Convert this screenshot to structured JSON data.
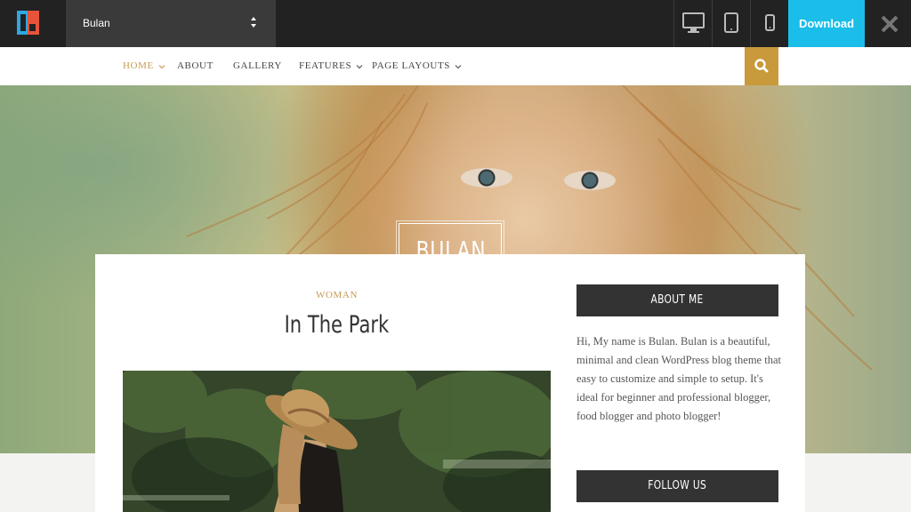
{
  "preview_bar": {
    "theme_name": "Bulan",
    "download_label": "Download",
    "devices": [
      "desktop-icon",
      "tablet-icon",
      "mobile-icon"
    ],
    "colors": {
      "bar": "#222222",
      "download": "#1bbde9"
    }
  },
  "site_nav": {
    "items": [
      {
        "label": "HOME",
        "dropdown": true,
        "active": true
      },
      {
        "label": "ABOUT",
        "dropdown": false,
        "active": false
      },
      {
        "label": "GALLERY",
        "dropdown": false,
        "active": false
      },
      {
        "label": "FEATURES",
        "dropdown": true,
        "active": false
      },
      {
        "label": "PAGE LAYOUTS",
        "dropdown": true,
        "active": false
      }
    ],
    "search_icon": "search-icon",
    "accent": "#c69a55",
    "search_bg": "#c99a3b"
  },
  "hero": {
    "brand": "BULAN"
  },
  "post": {
    "category": "WOMAN",
    "title": "In The Park"
  },
  "sidebar": {
    "about_heading": "ABOUT ME",
    "about_text": "Hi, My name is Bulan. Bulan is a beautiful, minimal and clean WordPress blog theme that easy to customize and simple to setup. It's ideal for beginner and professional blogger, food blogger and photo blogger!",
    "follow_heading": "FOLLOW US"
  }
}
